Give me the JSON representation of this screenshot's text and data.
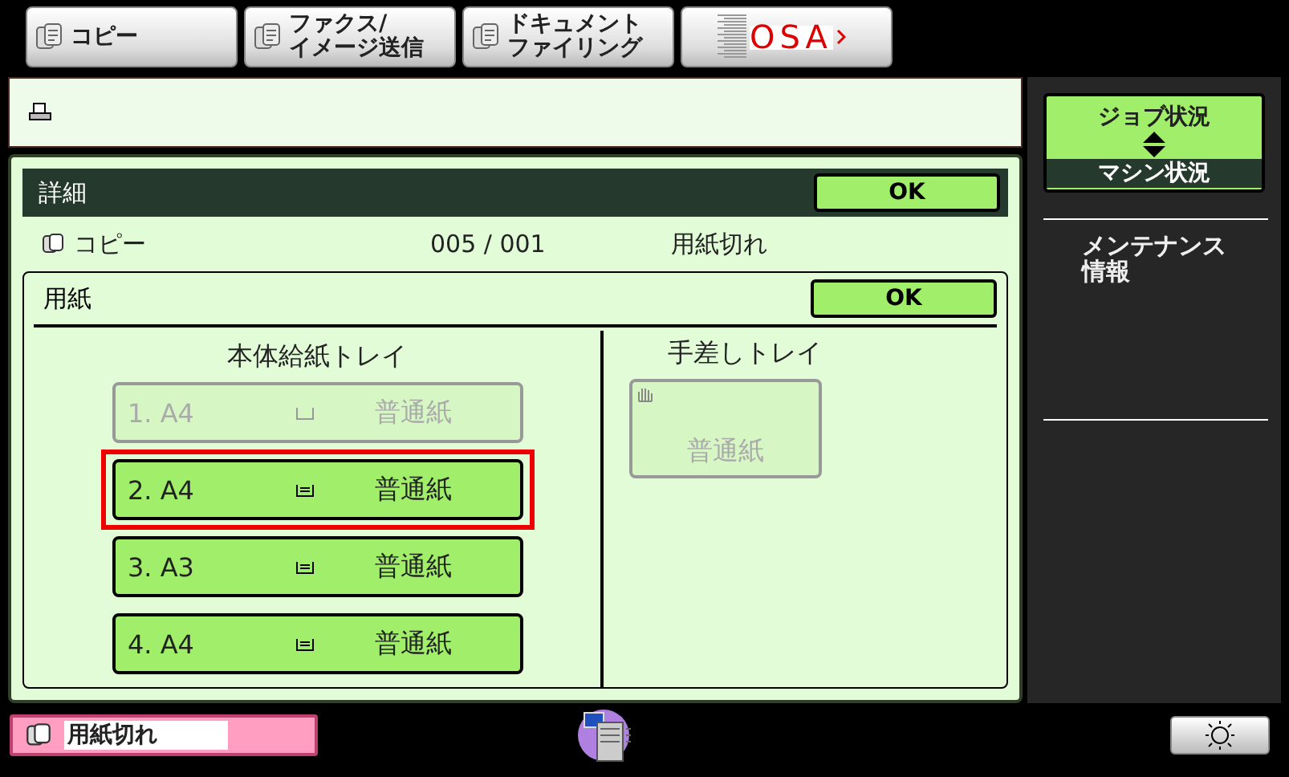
{
  "top_tabs": [
    {
      "label": "コピー",
      "selected": false
    },
    {
      "label": "ファクス/\nイメージ送信",
      "selected": false
    },
    {
      "label": "ドキュメントファイリング",
      "selected": false
    },
    {
      "label": "OSA",
      "kind": "logo",
      "selected": false
    }
  ],
  "detail": {
    "title": "詳細",
    "ok": "OK",
    "job": {
      "name": "コピー",
      "count": "005 / 001",
      "status": "用紙切れ"
    },
    "paper": {
      "title": "用紙",
      "ok": "OK",
      "main_tray": {
        "title": "本体給紙トレイ",
        "trays": [
          {
            "label": "1. A4",
            "type": "普通紙",
            "disabled": true,
            "selected": false,
            "loaded": false
          },
          {
            "label": "2. A4",
            "type": "普通紙",
            "disabled": false,
            "selected": true,
            "loaded": true
          },
          {
            "label": "3. A3",
            "type": "普通紙",
            "disabled": false,
            "selected": false,
            "loaded": true
          },
          {
            "label": "4. A4",
            "type": "普通紙",
            "disabled": false,
            "selected": false,
            "loaded": true
          }
        ]
      },
      "bypass_tray": {
        "title": "手差しトレイ",
        "type": "普通紙",
        "disabled": true
      }
    }
  },
  "sidebar": {
    "status_toggle": {
      "top": "ジョブ状況",
      "bottom": "マシン状況"
    },
    "items": [
      "メンテナンス情報"
    ]
  },
  "status_bar": {
    "message": "用紙切れ"
  }
}
